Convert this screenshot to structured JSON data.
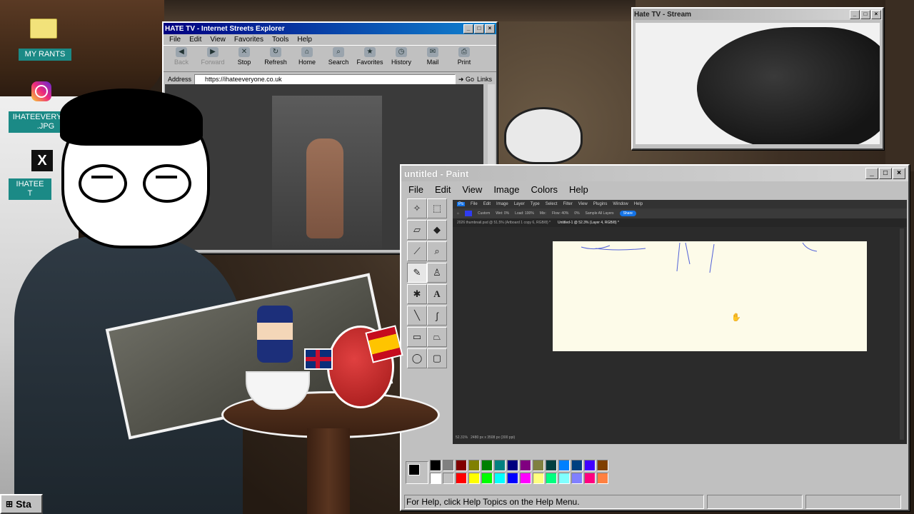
{
  "desktop": {
    "icons": [
      {
        "label": "MY RANTS",
        "icon": "folder-icon"
      },
      {
        "label": "",
        "icon": "instagram-icon"
      },
      {
        "label": "IHATEEVERYONE\n.JPG",
        "icon": "image-file-icon"
      },
      {
        "label": "",
        "icon": "x-icon"
      },
      {
        "label": "IHATEE\nT",
        "icon": "file-icon"
      }
    ]
  },
  "browser": {
    "title": "HATE TV - Internet Streets Explorer",
    "menu": [
      "File",
      "Edit",
      "View",
      "Favorites",
      "Tools",
      "Help"
    ],
    "toolbar": [
      {
        "label": "Back",
        "icon": "back-arrow-icon",
        "disabled": true
      },
      {
        "label": "Forward",
        "icon": "forward-arrow-icon",
        "disabled": true
      },
      {
        "label": "Stop",
        "icon": "stop-icon",
        "disabled": false
      },
      {
        "label": "Refresh",
        "icon": "refresh-icon",
        "disabled": false
      },
      {
        "label": "Home",
        "icon": "home-icon",
        "disabled": false
      },
      {
        "label": "Search",
        "icon": "search-icon",
        "disabled": false
      },
      {
        "label": "Favorites",
        "icon": "favorites-icon",
        "disabled": false
      },
      {
        "label": "History",
        "icon": "history-icon",
        "disabled": false
      },
      {
        "label": "Mail",
        "icon": "mail-icon",
        "disabled": false
      },
      {
        "label": "Print",
        "icon": "print-icon",
        "disabled": false
      }
    ],
    "address_label": "Address",
    "address_value": "https://ihateeveryone.co.uk",
    "go_label": "Go",
    "links_label": "Links"
  },
  "stream": {
    "title": "Hate TV - Stream"
  },
  "paint": {
    "title": "untitled - Paint",
    "menu": [
      "File",
      "Edit",
      "View",
      "Image",
      "Colors",
      "Help"
    ],
    "status_text": "For Help, click Help Topics on the Help Menu.",
    "palette": [
      "#000000",
      "#808080",
      "#800000",
      "#808000",
      "#008000",
      "#008080",
      "#000080",
      "#800080",
      "#808040",
      "#004040",
      "#0080ff",
      "#004080",
      "#4000ff",
      "#804000",
      "#ffffff",
      "#c0c0c0",
      "#ff0000",
      "#ffff00",
      "#00ff00",
      "#00ffff",
      "#0000ff",
      "#ff00ff",
      "#ffff80",
      "#00ff80",
      "#80ffff",
      "#8080ff",
      "#ff0080",
      "#ff8040"
    ],
    "fg_color": "#000000",
    "bg_color": "#ffffff"
  },
  "photoshop": {
    "menu": [
      "File",
      "Edit",
      "Image",
      "Layer",
      "Type",
      "Select",
      "Filter",
      "View",
      "Plugins",
      "Window",
      "Help"
    ],
    "options": [
      "Custom",
      "Wet: 0%",
      "Load: 100%",
      "Mix:",
      "Flow: 40%",
      "0%",
      "Sample All Layers"
    ],
    "share_label": "Share",
    "tabs": [
      "2026 thumbnail.psd @ 51.5% (Artboard 1 copy 6, RGB/8) *",
      "Untitled-1 @ 52.3% (Layer 4, RGB/8) *"
    ],
    "zoom": "52.31%",
    "doc_info": "2480 px x 3508 px (300 ppi)"
  },
  "taskbar": {
    "start_label": "Sta"
  },
  "colors": {
    "accent_teal": "#1b8a86",
    "canvas_cream": "#fdfbe9",
    "ps_share": "#1473e6"
  }
}
